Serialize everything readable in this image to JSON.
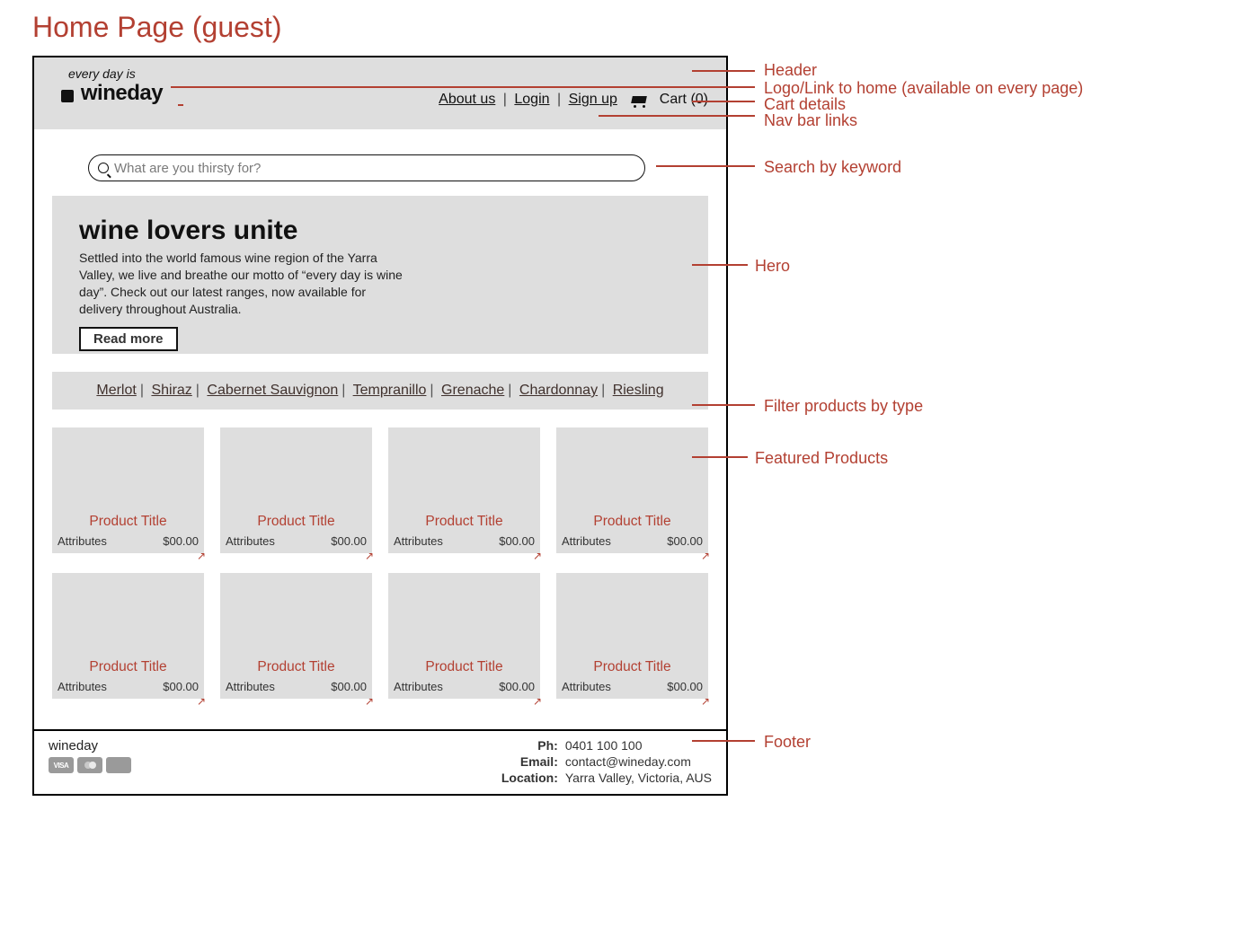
{
  "page_title": "Home Page (guest)",
  "header": {
    "logo_tagline": "every day is",
    "logo_main": "wineday",
    "nav": {
      "about": "About us",
      "login": "Login",
      "signup": "Sign up"
    },
    "cart_label": "Cart (0)"
  },
  "search": {
    "placeholder": "What are you thirsty for?"
  },
  "hero": {
    "heading": "wine lovers unite",
    "body": "Settled into the world famous wine region of the Yarra Valley, we live and breathe our motto of “every day is wine day”. Check out our latest ranges, now available for delivery throughout Australia.",
    "button": "Read more"
  },
  "filters": [
    "Merlot",
    "Shiraz",
    "Cabernet Sauvignon",
    "Tempranillo",
    "Grenache",
    "Chardonnay",
    "Riesling"
  ],
  "products": [
    {
      "title": "Product Title",
      "attrs": "Attributes",
      "price": "$00.00"
    },
    {
      "title": "Product Title",
      "attrs": "Attributes",
      "price": "$00.00"
    },
    {
      "title": "Product Title",
      "attrs": "Attributes",
      "price": "$00.00"
    },
    {
      "title": "Product Title",
      "attrs": "Attributes",
      "price": "$00.00"
    },
    {
      "title": "Product Title",
      "attrs": "Attributes",
      "price": "$00.00"
    },
    {
      "title": "Product Title",
      "attrs": "Attributes",
      "price": "$00.00"
    },
    {
      "title": "Product Title",
      "attrs": "Attributes",
      "price": "$00.00"
    },
    {
      "title": "Product Title",
      "attrs": "Attributes",
      "price": "$00.00"
    }
  ],
  "footer": {
    "brand": "wineday",
    "payment": [
      "VISA",
      "MC",
      "AMEX"
    ],
    "ph_label": "Ph:",
    "ph": "0401 100 100",
    "em_label": "Email:",
    "em": "contact@wineday.com",
    "loc_label": "Location:",
    "loc": "Yarra Valley, Victoria, AUS"
  },
  "annotations": {
    "header": "Header",
    "logo": "Logo/Link to home (available on every page)",
    "cart": "Cart details",
    "navlinks": "Nav bar links",
    "search": "Search by keyword",
    "hero": "Hero",
    "filters": "Filter products by type",
    "products": "Featured Products",
    "footer": "Footer"
  }
}
